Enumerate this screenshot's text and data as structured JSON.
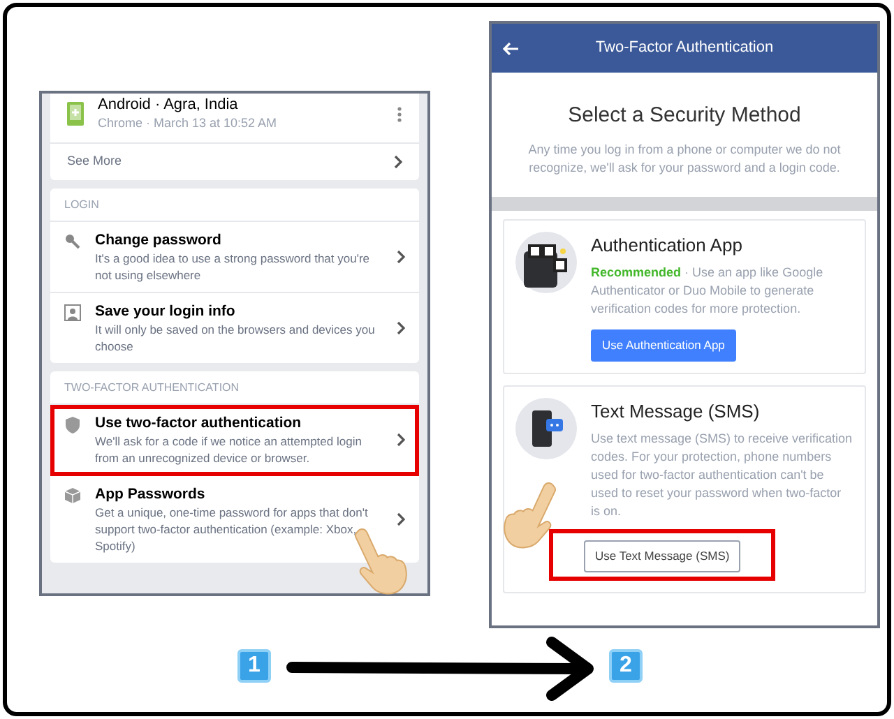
{
  "left_screen": {
    "device": {
      "title": "Android · Agra, India",
      "subtitle": "Chrome · March 13 at 10:52 AM"
    },
    "see_more": "See More",
    "sections": [
      {
        "header": "LOGIN",
        "items": [
          {
            "title": "Change password",
            "description": "It's a good idea to use a strong password that you're not using elsewhere",
            "highlighted": false
          },
          {
            "title": "Save your login info",
            "description": "It will only be saved on the browsers and devices you choose",
            "highlighted": false
          }
        ]
      },
      {
        "header": "TWO-FACTOR AUTHENTICATION",
        "items": [
          {
            "title": "Use two-factor authentication",
            "description": "We'll ask for a code if we notice an attempted login from an unrecognized device or browser.",
            "highlighted": true
          },
          {
            "title": "App Passwords",
            "description": "Get a unique, one-time password for apps that don't support two-factor authentication (example: Xbox, Spotify)",
            "highlighted": false
          }
        ]
      }
    ]
  },
  "right_screen": {
    "title": "Two-Factor Authentication",
    "heading": "Select a Security Method",
    "intro": "Any time you log in from a phone or computer we do not recognize, we'll ask for your password and a login code.",
    "methods": [
      {
        "title": "Authentication App",
        "tag": "Recommended",
        "description": " · Use an app like Google Authenticator or Duo Mobile to generate verification codes for more protection.",
        "button": {
          "label": "Use Authentication App"
        },
        "highlighted": false
      },
      {
        "title": "Text Message (SMS)",
        "description": "Use text message (SMS) to receive verification codes. For your protection, phone numbers used for two-factor authentication can't be used to reset your password when two-factor is on.",
        "button": {
          "label": "Use Text Message (SMS)"
        },
        "highlighted": true
      }
    ]
  },
  "steps": [
    "1",
    "2"
  ]
}
